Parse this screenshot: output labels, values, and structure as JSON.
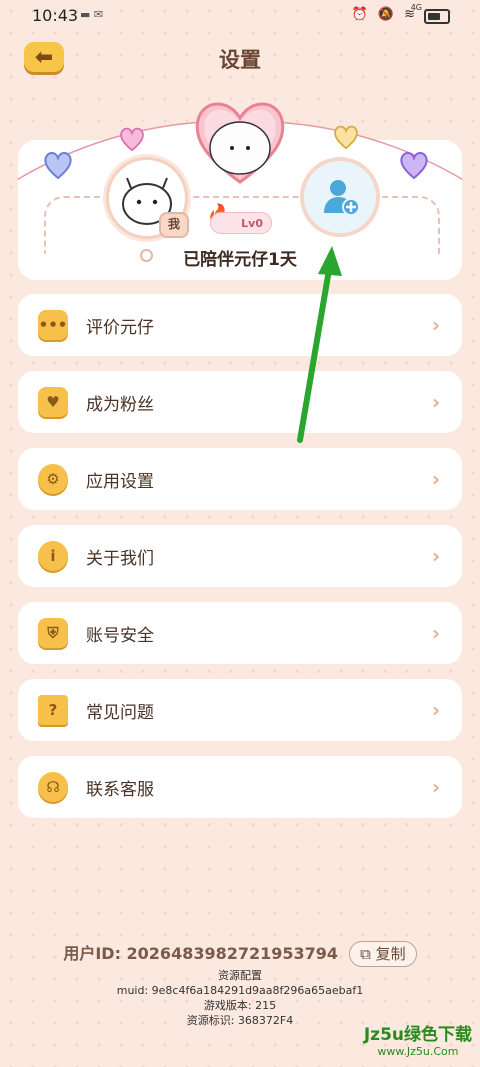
{
  "status_bar": {
    "time": "10:43",
    "network": "4G"
  },
  "header": {
    "title": "设置"
  },
  "profile": {
    "me_badge": "我",
    "level": "Lv0",
    "companion_text": "已陪伴元仔1天"
  },
  "menu": [
    {
      "label": "评价元仔",
      "icon": "chat-icon"
    },
    {
      "label": "成为粉丝",
      "icon": "heart-icon"
    },
    {
      "label": "应用设置",
      "icon": "gear-icon"
    },
    {
      "label": "关于我们",
      "icon": "info-icon"
    },
    {
      "label": "账号安全",
      "icon": "shield-user-icon"
    },
    {
      "label": "常见问题",
      "icon": "question-icon"
    },
    {
      "label": "联系客服",
      "icon": "headset-icon"
    }
  ],
  "footer": {
    "user_id": "用户ID: 2026483982721953794",
    "copy_label": "复制",
    "resource_config": "资源配置",
    "muid": "muid: 9e8c4f6a184291d9aa8f296a65aebaf1",
    "game_version": "游戏版本: 215",
    "resource_id": "资源标识: 368372F4"
  },
  "watermark": {
    "top": "Jz5u绿色下载",
    "bottom": "www.Jz5u.Com"
  },
  "colors": {
    "accent": "#f6c04a",
    "text": "#4b3226",
    "background": "#fbe9df",
    "arrow": "#2aa52e"
  }
}
